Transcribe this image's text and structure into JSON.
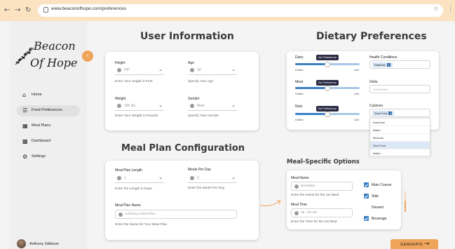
{
  "browser": {
    "url": "www.beaconofhope.com/preferences"
  },
  "sidebar": {
    "logo_line1": "Beacon",
    "logo_line2": "Of Hope",
    "items": [
      {
        "label": "Home",
        "icon": "home-icon"
      },
      {
        "label": "Food Preferences",
        "icon": "utensils-icon",
        "active": true
      },
      {
        "label": "Meal Plans",
        "icon": "meal-plans-icon"
      },
      {
        "label": "Dashboard",
        "icon": "dashboard-icon"
      },
      {
        "label": "Settings",
        "icon": "gear-icon"
      }
    ],
    "user_name": "Anthony Gibbson"
  },
  "user_info": {
    "title": "User Information",
    "height_label": "Height",
    "height_value": "5'8\"",
    "height_hint": "Enter Your Height in Feet",
    "age_label": "Age",
    "age_value": "18",
    "age_hint": "Specify Your Age",
    "weight_label": "Weight",
    "weight_value": "165 lbs",
    "weight_hint": "Enter Your Weight in Pounds",
    "gender_label": "Gender",
    "gender_value": "Male",
    "gender_hint": "Specify Your Gender"
  },
  "dietary": {
    "title": "Dietary Preferences",
    "sliders": [
      {
        "name": "Dairy",
        "bubble": "No Preference",
        "min": "Dislike",
        "max": "Like",
        "level": 0.5
      },
      {
        "name": "Meat",
        "bubble": "No Preference",
        "min": "Dislike",
        "max": "Like",
        "level": 0.5
      },
      {
        "name": "Nuts",
        "bubble": "No Preference",
        "min": "Dislike",
        "max": "Like",
        "level": 0.5
      }
    ],
    "health_label": "Health Conditions",
    "health_chip": "Diabetes",
    "diets_label": "Diets",
    "diets_placeholder": "Select Diets",
    "cuisines_label": "Cuisines",
    "cuisines_chip": "Soul Food",
    "cuisine_options": [
      "American",
      "Italian",
      "Mexican",
      "Soul Food",
      "Italian"
    ]
  },
  "meal_plan": {
    "title": "Meal Plan Configuration",
    "length_label": "Meal Plan Length",
    "length_value": "1",
    "length_hint": "Enter the Length in Days",
    "per_day_label": "Meals Per Day",
    "per_day_value": "3",
    "per_day_hint": "Enter the Meals Per Day",
    "name_label": "Meal Plan Name",
    "name_placeholder": "Anthony's Meal Plan",
    "name_hint": "Enter the Name for Your Meal Plan"
  },
  "meal_specific": {
    "title": "Meal-Specific Options",
    "meal_name_label": "Meal Name",
    "meal_name_placeholder": "Breakfast...",
    "meal_name_hint": "Enter the Name for the 1st Meal",
    "meal_time_label": "Meal Time",
    "meal_time_placeholder": "06 : 00 AM",
    "meal_time_hint": "Enter the Time for the 1st Meal",
    "options": [
      {
        "label": "Main Course",
        "checked": true
      },
      {
        "label": "Side",
        "checked": true
      },
      {
        "label": "Dessert",
        "checked": false
      },
      {
        "label": "Beverage",
        "checked": true
      }
    ],
    "scroll_level": 0.55
  },
  "generate_label": "GENERATE",
  "colors": {
    "chrome": "#fbe3c2",
    "accent": "#f0a45a",
    "check": "#3b7fc4"
  }
}
